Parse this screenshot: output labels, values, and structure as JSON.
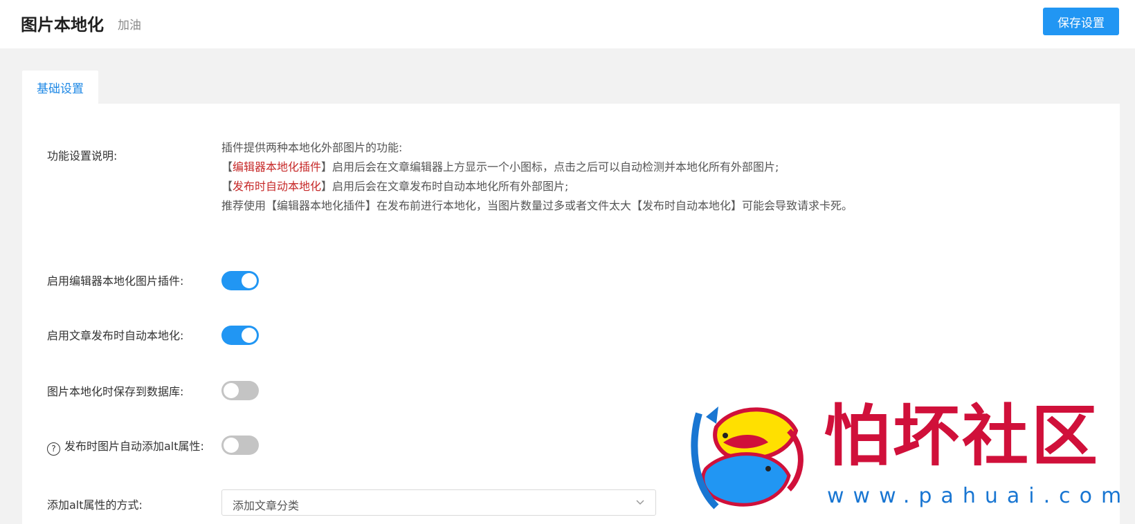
{
  "header": {
    "title": "图片本地化",
    "subtitle": "加油",
    "save_label": "保存设置"
  },
  "tabs": [
    {
      "label": "基础设置",
      "active": true
    }
  ],
  "settings": {
    "description": {
      "label": "功能设置说明:",
      "line1": "插件提供两种本地化外部图片的功能:",
      "line2_open": "【",
      "line2_highlight": "编辑器本地化插件",
      "line2_rest": "】启用后会在文章编辑器上方显示一个小图标，点击之后可以自动检测并本地化所有外部图片;",
      "line3_open": "【",
      "line3_highlight": "发布时自动本地化",
      "line3_rest": "】启用后会在文章发布时自动本地化所有外部图片;",
      "line4": "推荐使用【编辑器本地化插件】在发布前进行本地化，当图片数量过多或者文件太大【发布时自动本地化】可能会导致请求卡死。"
    },
    "editor_plugin": {
      "label": "启用编辑器本地化图片插件:",
      "enabled": true
    },
    "auto_publish": {
      "label": "启用文章发布时自动本地化:",
      "enabled": true
    },
    "save_db": {
      "label": "图片本地化时保存到数据库:",
      "enabled": false
    },
    "auto_alt": {
      "label": "发布时图片自动添加alt属性:",
      "enabled": false,
      "help_glyph": "?"
    },
    "alt_method": {
      "label": "添加alt属性的方式:",
      "value": "添加文章分类"
    }
  },
  "watermark": {
    "text": "怕坏社区",
    "url": "www.pahuai.com"
  },
  "colors": {
    "accent": "#2196f3",
    "highlight": "#c62828",
    "toggle_off": "#c4c4c4"
  }
}
